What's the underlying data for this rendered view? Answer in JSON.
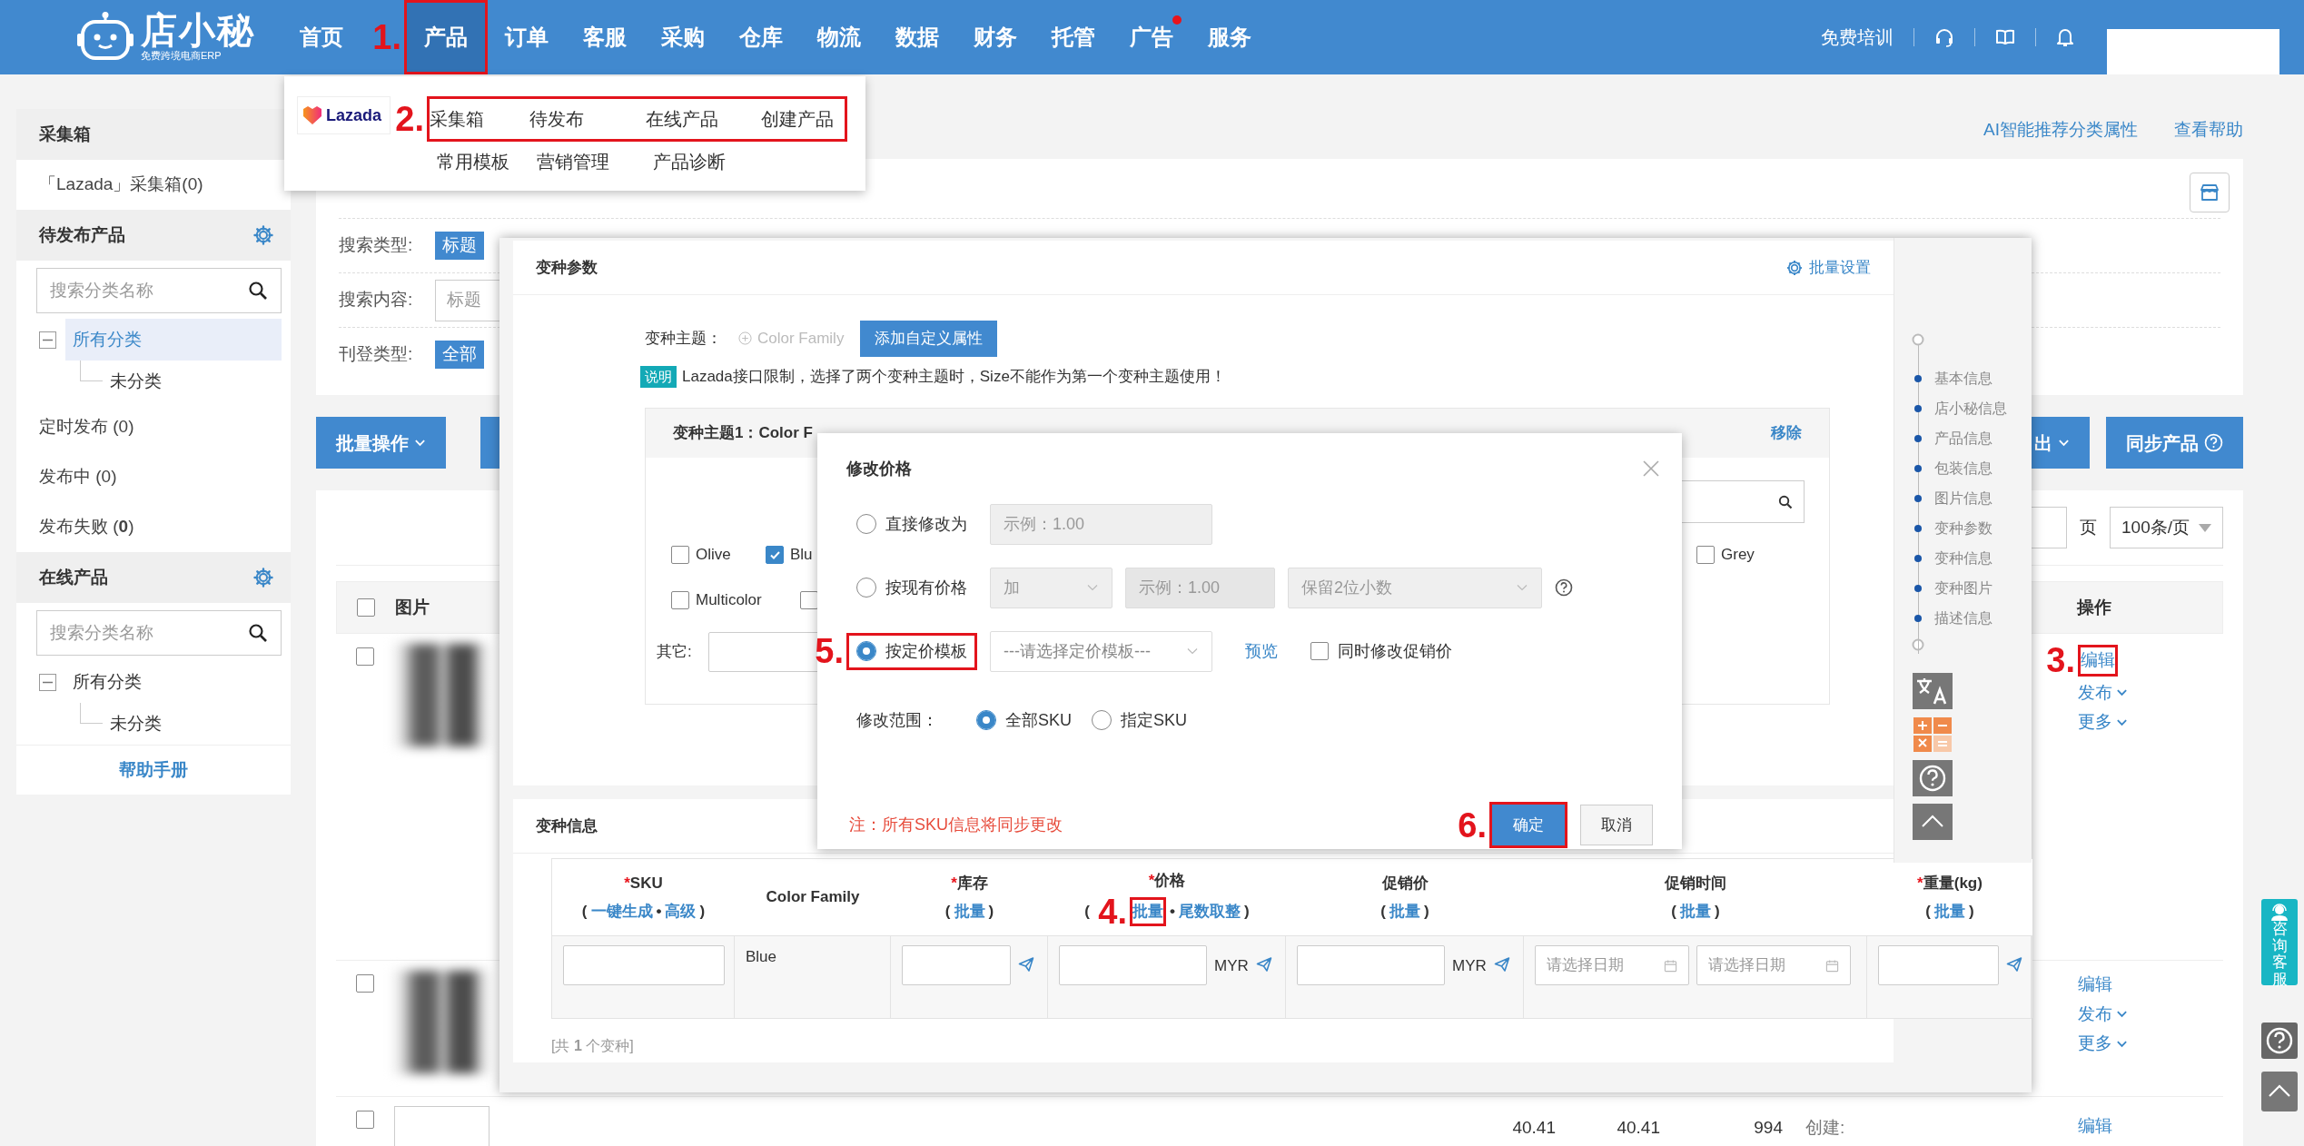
{
  "navbar": {
    "brand": {
      "title": "店小秘",
      "subtitle": "免费跨境电商ERP"
    },
    "items": [
      {
        "label": "首页",
        "selected": false,
        "notification": false
      },
      {
        "label": "产品",
        "selected": true,
        "notification": false,
        "annotation": "1."
      },
      {
        "label": "订单",
        "selected": false,
        "notification": false
      },
      {
        "label": "客服",
        "selected": false,
        "notification": false
      },
      {
        "label": "采购",
        "selected": false,
        "notification": false
      },
      {
        "label": "仓库",
        "selected": false,
        "notification": false
      },
      {
        "label": "物流",
        "selected": false,
        "notification": false
      },
      {
        "label": "数据",
        "selected": false,
        "notification": false
      },
      {
        "label": "财务",
        "selected": false,
        "notification": false
      },
      {
        "label": "托管",
        "selected": false,
        "notification": false
      },
      {
        "label": "广告",
        "selected": false,
        "notification": true
      },
      {
        "label": "服务",
        "selected": false,
        "notification": false
      }
    ],
    "training": "免费培训"
  },
  "product_menu": {
    "platform": "Lazada",
    "rows": [
      {
        "items": [
          "采集箱",
          "待发布",
          "在线产品",
          "创建产品"
        ],
        "annotation": "2."
      },
      {
        "items": [
          "常用模板",
          "营销管理",
          "产品诊断"
        ]
      }
    ]
  },
  "sidebar": {
    "sections": [
      {
        "title": "采集箱",
        "links": [
          "「Lazada」采集箱(0)"
        ]
      },
      {
        "title": "待发布产品",
        "settings": true,
        "search_placeholder": "搜索分类名称",
        "tree": [
          {
            "label": "所有分类",
            "selected": true,
            "expanded": true,
            "children": [
              {
                "label": "未分类",
                "selected": false
              }
            ]
          }
        ],
        "links": [
          "定时发布 (0)",
          "发布中 (0)",
          "发布失败 (**0**)"
        ]
      },
      {
        "title": "在线产品",
        "settings": true,
        "search_placeholder": "搜索分类名称",
        "tree": [
          {
            "label": "所有分类",
            "selected": false,
            "expanded": true,
            "children": [
              {
                "label": "未分类",
                "selected": false
              }
            ]
          }
        ]
      }
    ],
    "help": "帮助手册"
  },
  "main": {
    "top_links": [
      "AI智能推荐分类属性",
      "查看帮助"
    ],
    "filters": [
      {
        "label": "搜索类型:",
        "kind": "tag",
        "value": "标题"
      },
      {
        "label": "搜索内容:",
        "kind": "input",
        "placeholder": "标题"
      },
      {
        "label": "刊登类型:",
        "kind": "tag",
        "value": "全部"
      }
    ],
    "toolbar": {
      "left": [
        {
          "label": "批量操作",
          "menu": true
        },
        {
          "menu": false
        }
      ],
      "right": [
        {
          "label": "出",
          "menu": true,
          "help": false
        },
        {
          "label": "同步产品",
          "menu": false,
          "help": true
        }
      ]
    },
    "pagination": {
      "page_unit": "页",
      "page_size": "100条/页"
    },
    "table": {
      "select_all_checked": false,
      "columns": [
        "图片",
        "操作"
      ],
      "rows": [
        {
          "checked": false,
          "actions": [
            {
              "label": "编辑",
              "menu": false,
              "annotation": "3."
            },
            {
              "label": "发布",
              "menu": true
            },
            {
              "label": "更多",
              "menu": true
            }
          ]
        },
        {
          "checked": false,
          "actions": [
            {
              "label": "编辑",
              "menu": false
            },
            {
              "label": "发布",
              "menu": true
            },
            {
              "label": "更多",
              "menu": true
            }
          ]
        },
        {
          "checked": false,
          "values": [
            "40.41",
            "40.41",
            "994",
            "创建:"
          ],
          "actions": [
            {
              "label": "编辑",
              "menu": false
            }
          ]
        }
      ]
    }
  },
  "edit_panel": {
    "variant_params": {
      "title": "变种参数",
      "batch_settings": "批量设置",
      "theme_label": "变种主题：",
      "theme_option": "Color Family",
      "add_button": "添加自定义属性",
      "notice_tag": "说明",
      "notice": "Lazada接口限制，选择了两个变种主题时，Size不能作为第一个变种主题使用！",
      "theme_card": {
        "title": "变种主题1：Color F",
        "remove": "移除",
        "option_rows": [
          [
            {
              "label": "Olive",
              "checked": false
            },
            {
              "label": "Blu",
              "checked": true
            },
            {
              "label": "Grey",
              "checked": false
            }
          ],
          [
            {
              "label": "Multicolor",
              "checked": false
            },
            {
              "checked": false
            }
          ]
        ],
        "other_label": "其它:"
      }
    },
    "variant_info": {
      "title": "变种信息",
      "required_mark": "*",
      "paren_open": "(",
      "paren_close": ")",
      "separator": "•",
      "columns": [
        {
          "title": "SKU",
          "required": true,
          "links": [
            {
              "label": "一键生成"
            },
            {
              "label": "高级"
            }
          ]
        },
        {
          "title": "Color Family",
          "required": false
        },
        {
          "title": "库存",
          "required": true,
          "links": [
            {
              "label": "批量"
            }
          ]
        },
        {
          "title": "价格",
          "required": true,
          "links": [
            {
              "label": "批量",
              "annotation": "4."
            },
            {
              "label": "尾数取整"
            }
          ]
        },
        {
          "title": "促销价",
          "required": false,
          "links": [
            {
              "label": "批量"
            }
          ]
        },
        {
          "title": "促销时间",
          "required": false,
          "links": [
            {
              "label": "批量"
            }
          ]
        },
        {
          "title": "重量(kg)",
          "required": true,
          "links": [
            {
              "label": "批量"
            }
          ]
        }
      ],
      "row": [
        {
          "kind": "input",
          "send": false
        },
        {
          "kind": "text",
          "text": "Blue"
        },
        {
          "kind": "input",
          "send": true
        },
        {
          "kind": "input",
          "unit": "MYR",
          "send": true
        },
        {
          "kind": "input",
          "unit": "MYR",
          "send": true
        },
        {
          "kind": "dates",
          "placeholders": [
            "请选择日期",
            "请选择日期"
          ]
        },
        {
          "kind": "input",
          "send": true
        }
      ],
      "footer": "[共 **1** 个变种]"
    },
    "rail": {
      "items": [
        "基本信息",
        "店小秘信息",
        "产品信息",
        "包装信息",
        "图片信息",
        "变种参数",
        "变种信息",
        "变种图片",
        "描述信息"
      ]
    }
  },
  "price_dialog": {
    "title": "修改价格",
    "options": [
      {
        "kind": "direct",
        "label": "直接修改为",
        "selected": false,
        "placeholder": "示例：1.00"
      },
      {
        "kind": "relative",
        "label": "按现有价格",
        "selected": false,
        "operator": "加",
        "placeholder": "示例：1.00",
        "rounding": "保留2位小数"
      },
      {
        "kind": "template",
        "label": "按定价模板",
        "selected": true,
        "annotation": "5.",
        "template_placeholder": "---请选择定价模板---",
        "preview": "预览",
        "sync_promo": {
          "label": "同时修改促销价",
          "checked": false
        }
      }
    ],
    "scope": {
      "label": "修改范围：",
      "options": [
        {
          "label": "全部SKU",
          "selected": true
        },
        {
          "label": "指定SKU",
          "selected": false
        }
      ]
    },
    "note": "注：所有SKU信息将同步更改",
    "confirm": {
      "label": "确定",
      "annotation": "6."
    },
    "cancel": "取消"
  },
  "float_buttons": {
    "service": "咨询客服"
  }
}
